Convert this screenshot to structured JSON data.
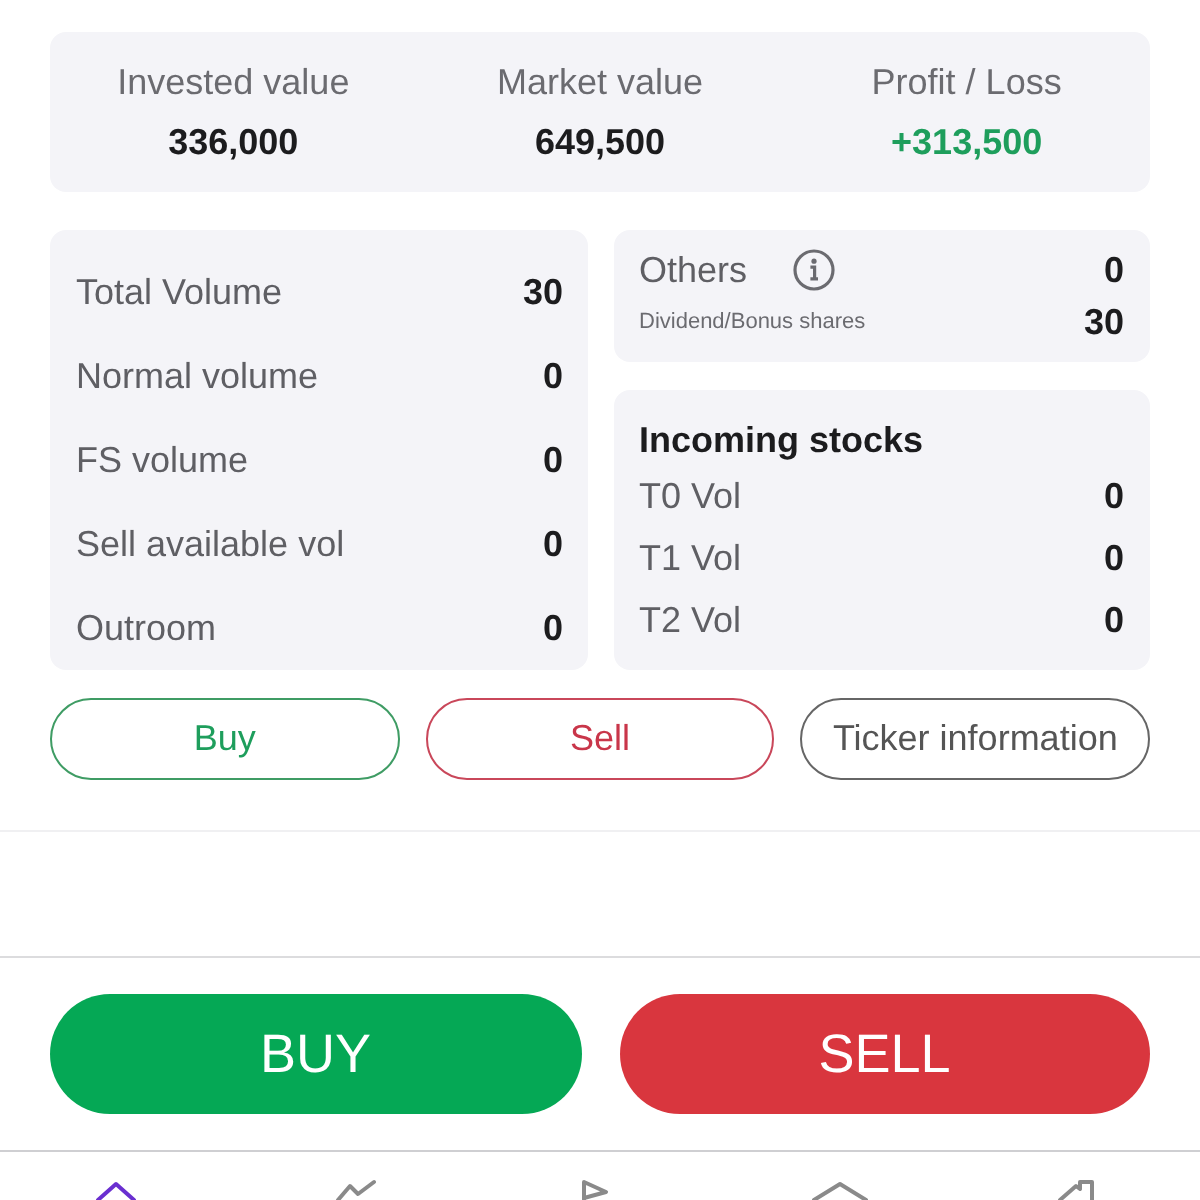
{
  "summary": [
    {
      "label": "Invested value",
      "value": "336,000",
      "kind": "amount"
    },
    {
      "label": "Market value",
      "value": "649,500",
      "kind": "amount"
    },
    {
      "label": "Profit / Loss",
      "value": "+313,500",
      "kind": "gain"
    }
  ],
  "volumes": [
    {
      "label": "Total Volume",
      "value": "30"
    },
    {
      "label": "Normal volume",
      "value": "0"
    },
    {
      "label": "FS volume",
      "value": "0"
    },
    {
      "label": "Sell available vol",
      "value": "0"
    },
    {
      "label": "Outroom",
      "value": "0"
    }
  ],
  "others": {
    "label": "Others",
    "value": "0",
    "detail": {
      "label": "Dividend/Bonus shares",
      "value": "30"
    }
  },
  "incoming": {
    "title": "Incoming stocks",
    "rows": [
      {
        "label": "T0 Vol",
        "value": "0"
      },
      {
        "label": "T1 Vol",
        "value": "0"
      },
      {
        "label": "T2 Vol",
        "value": "0"
      }
    ]
  },
  "actions": [
    {
      "label": "Buy",
      "kind": "buy"
    },
    {
      "label": "Sell",
      "kind": "sell"
    },
    {
      "label": "Ticker information",
      "kind": "neutral"
    }
  ],
  "order_buttons": [
    {
      "label": "BUY",
      "kind": "buy"
    },
    {
      "label": "SELL",
      "kind": "sell"
    }
  ],
  "nav": [
    {
      "selected": true
    },
    {
      "selected": false
    },
    {
      "selected": false
    },
    {
      "selected": false
    },
    {
      "selected": false
    }
  ]
}
